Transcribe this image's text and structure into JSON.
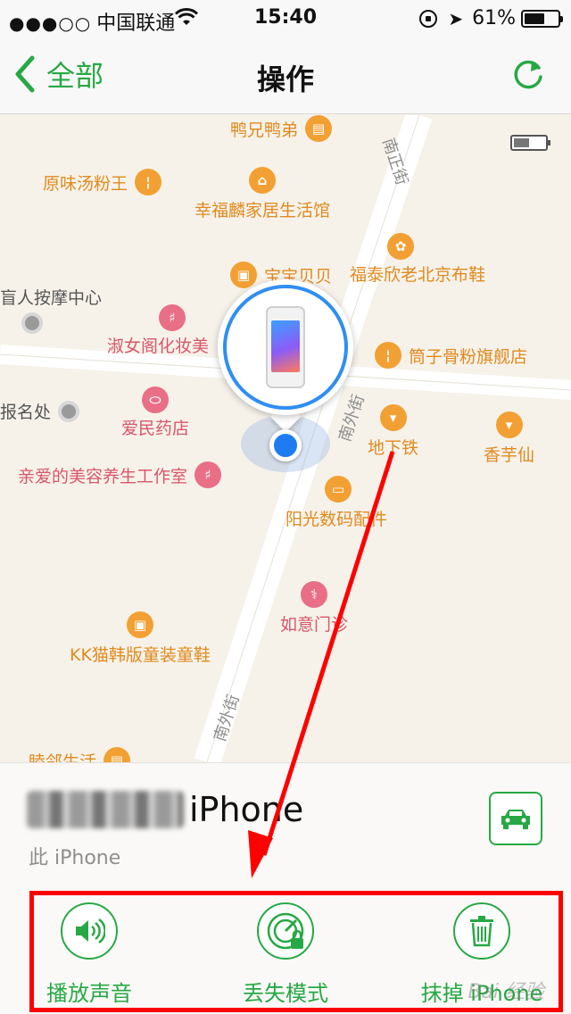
{
  "status_bar": {
    "signal": "●●●○○",
    "carrier": "中国联通",
    "time": "15:40",
    "battery_percent": "61%",
    "battery_level": 0.61
  },
  "nav": {
    "back_label": "全部",
    "title": "操作"
  },
  "map": {
    "pois": [
      {
        "label": "鸭兄鸭弟",
        "icon": "food-icon"
      },
      {
        "label": "原味汤粉王",
        "icon": "restaurant-icon"
      },
      {
        "label": "幸福麟家居生活馆",
        "icon": "furniture-icon"
      },
      {
        "label": "福泰欣老北京布鞋",
        "icon": "shoe-shop-icon"
      },
      {
        "label": "宝宝贝贝",
        "icon": "shopping-bag-icon"
      },
      {
        "label": "盲人按摩中心",
        "icon": "place-icon"
      },
      {
        "label": "淑女阁化妆美",
        "icon": "cosmetics-icon"
      },
      {
        "label": "筒子骨粉旗舰店",
        "icon": "restaurant-icon"
      },
      {
        "label": "报名处",
        "icon": "place-icon"
      },
      {
        "label": "爱民药店",
        "icon": "pharmacy-icon"
      },
      {
        "label": "地下铁",
        "icon": "ice-cream-icon"
      },
      {
        "label": "香芋仙",
        "icon": "ice-cream-icon"
      },
      {
        "label": "亲爱的美容养生工作室",
        "icon": "beauty-icon"
      },
      {
        "label": "阳光数码配件",
        "icon": "electronics-icon"
      },
      {
        "label": "如意门诊",
        "icon": "clinic-icon"
      },
      {
        "label": "KK猫韩版童装童鞋",
        "icon": "shopping-bag-icon"
      },
      {
        "label": "睦邻生活",
        "icon": "store-icon"
      }
    ],
    "streets": [
      "南正街",
      "南外街",
      "南外街"
    ],
    "device_battery_level": 0.5
  },
  "device": {
    "name": "iPhone",
    "subtitle": "此 iPhone"
  },
  "actions": [
    {
      "label": "播放声音",
      "icon": "speaker-icon"
    },
    {
      "label": "丢失模式",
      "icon": "lost-mode-icon"
    },
    {
      "label": "抹掉 iPhone",
      "icon": "trash-icon"
    }
  ],
  "watermark": "Bai 经验",
  "colors": {
    "accent": "#27a844",
    "annotation": "#ff0000",
    "location": "#1f7cf0"
  }
}
